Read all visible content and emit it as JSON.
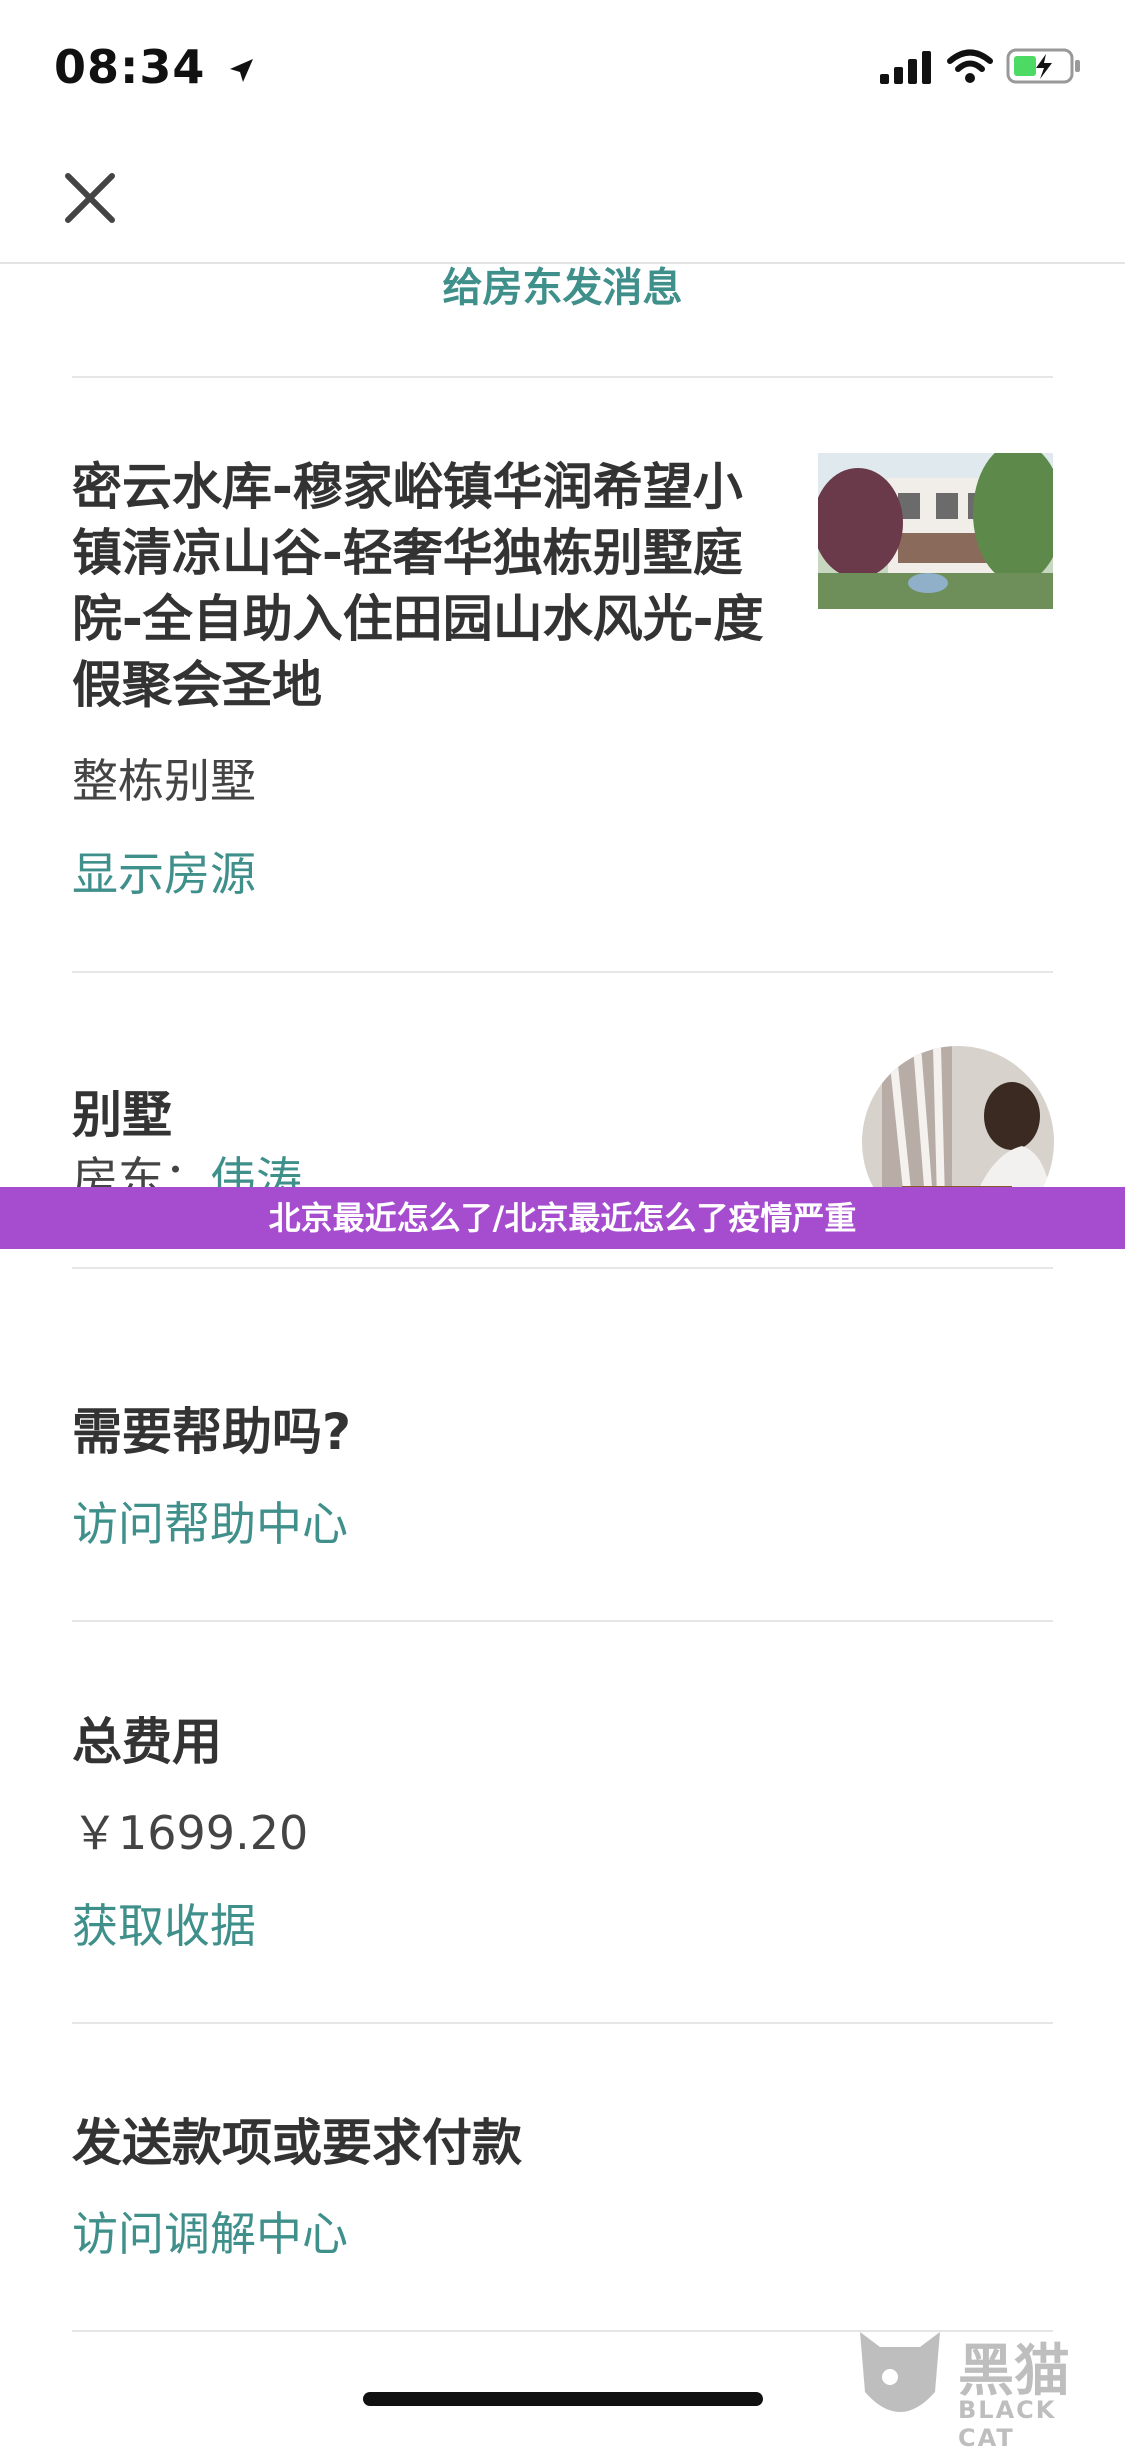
{
  "status_bar": {
    "time": "08:34"
  },
  "nav": {
    "close_icon": "close-icon"
  },
  "message_host": {
    "label": "给房东发消息"
  },
  "listing": {
    "title_lines": [
      "密云水库-穆家峪镇华润希望小",
      "镇清凉山谷-轻奢华独栋别墅庭",
      "院-全自助入住田园山水风光-度",
      "假聚会圣地"
    ],
    "type": "整栋别墅",
    "show_listing": "显示房源"
  },
  "host": {
    "title": "别墅",
    "host_label": "房东：",
    "host_name": "伟涛"
  },
  "overlay_banner": {
    "text": "北京最近怎么了/北京最近怎么了疫情严重"
  },
  "help": {
    "title": "需要帮助吗?",
    "link": "访问帮助中心"
  },
  "cost": {
    "title": "总费用",
    "amount": "￥1699.20",
    "receipt_link": "获取收据"
  },
  "payment": {
    "title": "发送款项或要求付款",
    "link": "访问调解中心"
  },
  "watermark": {
    "cn": "黑猫",
    "en": "BLACK CAT"
  },
  "colors": {
    "accent": "#3f8f8b",
    "banner": "#a64ccf"
  }
}
